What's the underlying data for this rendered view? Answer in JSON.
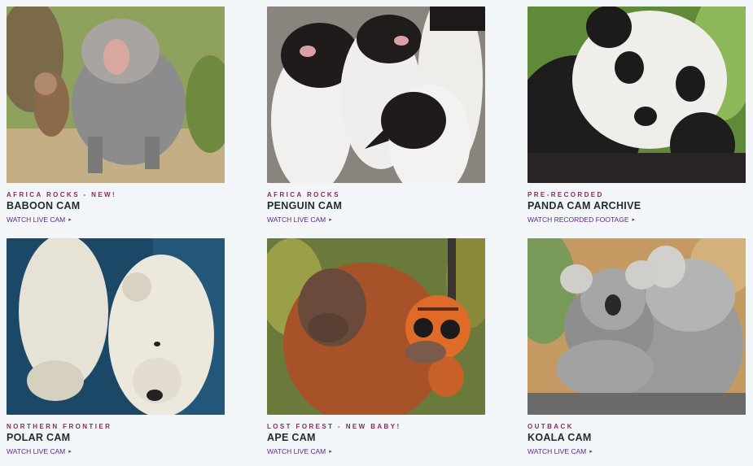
{
  "cams": [
    {
      "tag": "Africa Rocks - New!",
      "title": "BABOON CAM",
      "link": "WATCH LIVE CAM",
      "image": "baboon-photo",
      "palette": [
        "#8a9a5a",
        "#c9b28a",
        "#8c8c8c",
        "#b0a89a"
      ]
    },
    {
      "tag": "Africa Rocks",
      "title": "PENGUIN CAM",
      "link": "WATCH LIVE CAM",
      "image": "penguin-photo",
      "palette": [
        "#8d8680",
        "#1e1b1a",
        "#f2f0ee",
        "#d9a0a8"
      ]
    },
    {
      "tag": "Pre-Recorded",
      "title": "PANDA CAM ARCHIVE",
      "link": "WATCH RECORDED FOOTAGE",
      "image": "panda-photo",
      "palette": [
        "#5f8a3a",
        "#1c1a1a",
        "#f0eeea",
        "#9cc26a"
      ]
    },
    {
      "tag": "Northern Frontier",
      "title": "POLAR CAM",
      "link": "WATCH LIVE CAM",
      "image": "polar-bear-photo",
      "palette": [
        "#1e4a6a",
        "#2e6a8a",
        "#e8e4d8",
        "#c8c0ae"
      ]
    },
    {
      "tag": "Lost Forest - New Baby!",
      "title": "APE CAM",
      "link": "WATCH LIVE CAM",
      "image": "orangutan-photo",
      "palette": [
        "#6a7a3a",
        "#a8522a",
        "#c8703a",
        "#e06a28"
      ]
    },
    {
      "tag": "Outback",
      "title": "KOALA CAM",
      "link": "WATCH LIVE CAM",
      "image": "koala-photo",
      "palette": [
        "#c9a26a",
        "#9a9a9a",
        "#c8c8c8",
        "#7a9a5a"
      ]
    }
  ]
}
